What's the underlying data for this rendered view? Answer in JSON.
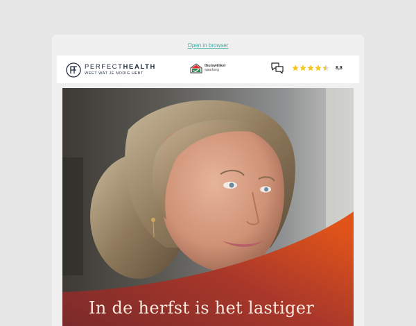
{
  "preheader": {
    "open_in_browser": "Open in browser"
  },
  "brand": {
    "name_thin": "PERFECT",
    "name_bold": "HEALTH",
    "tagline": "WEET WAT JE NODIG HEBT",
    "logo_icon": "pf-monogram-icon"
  },
  "trust": {
    "name": "thuiswinkel",
    "sub": "waarborg",
    "icon": "thuiswinkel-house-icon"
  },
  "reviews": {
    "icon": "chat-bubbles-icon",
    "stars": 4.5,
    "score": "8,8",
    "star_color": "#f5c518"
  },
  "hero": {
    "image": "portrait-of-smiling-woman",
    "headline": "In de herfst is het lastiger",
    "accent_gradient": [
      "#7a2a2a",
      "#e0541a"
    ]
  }
}
